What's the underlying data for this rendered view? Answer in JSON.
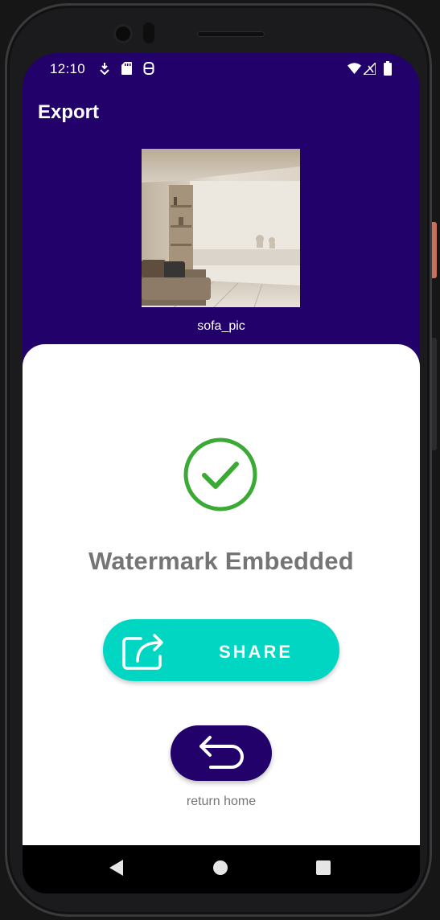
{
  "status_bar": {
    "time": "12:10",
    "left_icons": [
      "download-app-icon",
      "sd-card-icon",
      "accessibility-icon"
    ],
    "right_icons": [
      "wifi-icon",
      "signal-icon",
      "battery-icon"
    ]
  },
  "app": {
    "title": "Export"
  },
  "preview": {
    "image_name": "sofa_pic"
  },
  "result": {
    "status_icon": "check-circle-icon",
    "headline": "Watermark Embedded"
  },
  "share_button": {
    "icon": "share-icon",
    "label": "SHARE"
  },
  "home_button": {
    "icon": "return-arrow-icon",
    "caption": "return home"
  },
  "nav_bar": {
    "buttons": [
      "back",
      "home",
      "recents"
    ]
  },
  "colors": {
    "primary": "#22016b",
    "accent": "#01d6c3",
    "success": "#3aaa35",
    "headline_text": "#757575"
  }
}
